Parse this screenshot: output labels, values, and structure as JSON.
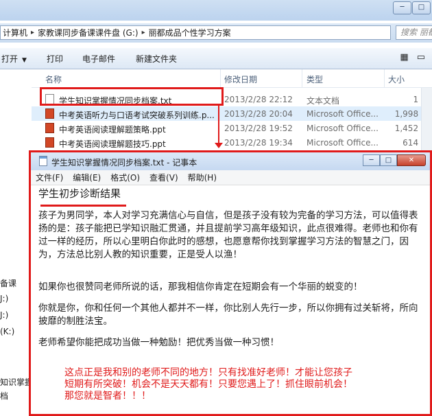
{
  "explorer": {
    "address_segments": [
      "计算机",
      "家教课同步备课课件盘 (G:)",
      "丽都成品个性学习方案"
    ],
    "search_placeholder": "搜索 丽都",
    "toolbar": {
      "open": "打开",
      "print": "打印",
      "email": "电子邮件",
      "new_folder": "新建文件夹"
    },
    "left_pane": [
      "备课",
      "J:)",
      "J:)",
      "(K:)",
      "知识掌握",
      "档"
    ],
    "columns": {
      "name": "名称",
      "date": "修改日期",
      "type": "类型",
      "size": "大小"
    },
    "files": [
      {
        "name": "学生知识掌握情况同步档案.txt",
        "date": "2013/2/28 22:12",
        "type": "文本文档",
        "size": "1 KB",
        "icon": "txt-file-icon"
      },
      {
        "name": "中考英语听力与口语考试突破系列训练.p...",
        "date": "2013/2/28 20:04",
        "type": "Microsoft Office...",
        "size": "1,998 KB",
        "icon": "ppt-file-icon"
      },
      {
        "name": "中考英语阅读理解题策略.ppt",
        "date": "2013/2/28 19:52",
        "type": "Microsoft Office...",
        "size": "1,452 KB",
        "icon": "ppt-file-icon"
      },
      {
        "name": "中考英语阅读理解题技巧.ppt",
        "date": "2013/2/28 19:34",
        "type": "Microsoft Office...",
        "size": "614 KB",
        "icon": "ppt-file-icon"
      }
    ]
  },
  "notepad": {
    "title": "学生知识掌握情况同步档案.txt - 记事本",
    "menu": [
      "文件(F)",
      "编辑(E)",
      "格式(O)",
      "查看(V)",
      "帮助(H)"
    ],
    "heading": "学生初步诊断结果",
    "paragraphs": [
      "孩子为男同学，本人对学习充满信心与自信，但是孩子没有较为完备的学习方法，可以值得表扬的是：孩子能把已学知识融汇贯通，并且提前学习高年级知识，此点很难得。老师也和你有过一样的经历，所以心里明白你此时的感想，也愿意帮你找到掌握学习方法的智慧之门，因为，方法总比别人教的知识重要，正是受人以渔！",
      "如果你也很赞同老师所说的话，那我相信你肯定在短期会有一个华丽的蜕变的！",
      "你就是你，你和任何一个其他人都并不一样，你比别人先行一步，所以你拥有过关斩将，所向披靡的制胜法宝。",
      "老师希望你能把成功当做一种勉励！把优秀当做一种习惯！"
    ],
    "note_lines": [
      "这点正是我和别的老师不同的地方！只有找准好老师！才能让您孩子",
      "短期有所突破！机会不是天天都有！只要您遇上了！抓住眼前机会！",
      "那您就是智者！！！"
    ],
    "accent_color": "#e01a1a"
  }
}
